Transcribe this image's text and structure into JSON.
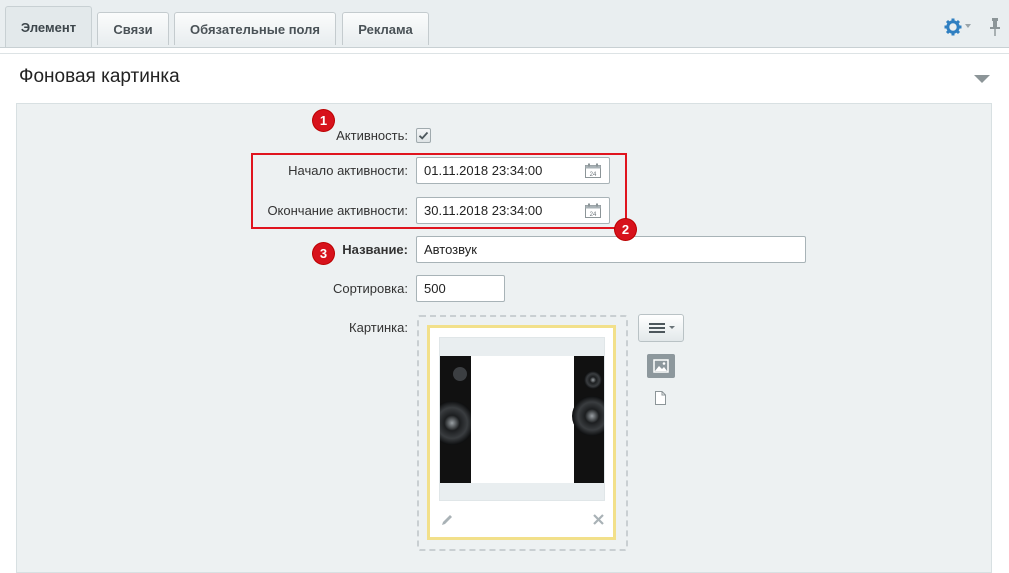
{
  "tabs": [
    {
      "label": "Элемент",
      "active": true
    },
    {
      "label": "Связи",
      "active": false
    },
    {
      "label": "Обязательные поля",
      "active": false
    },
    {
      "label": "Реклама",
      "active": false
    }
  ],
  "toolbar": {
    "settings_icon": "gear-icon",
    "pin_icon": "pin-icon"
  },
  "section": {
    "title": "Фоновая картинка"
  },
  "form": {
    "active_label": "Активность:",
    "active_checked": true,
    "start_label": "Начало активности:",
    "start_value": "01.11.2018 23:34:00",
    "end_label": "Окончание активности:",
    "end_value": "30.11.2018 23:34:00",
    "calendar_day": "24",
    "name_label": "Название:",
    "name_value": "Автозвук",
    "sort_label": "Сортировка:",
    "sort_value": "500",
    "picture_label": "Картинка:"
  },
  "annotations": {
    "badge1": "1",
    "badge2": "2",
    "badge3": "3"
  },
  "colors": {
    "accent": "#d7121c",
    "highlight_border": "#f2e08a",
    "gear": "#2f7fc1"
  }
}
